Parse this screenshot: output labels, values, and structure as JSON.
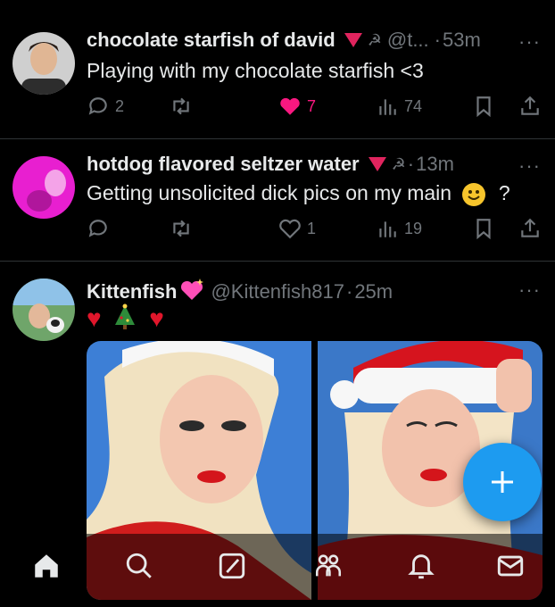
{
  "posts": [
    {
      "author": "chocolate starfish of david",
      "handle": "@t...",
      "time": "53m",
      "text": "Playing with my chocolate starfish <3",
      "replies": "2",
      "reposts": "",
      "likes": "7",
      "views": "74",
      "liked": true
    },
    {
      "author": "hotdog flavored seltzer water",
      "handle": "",
      "time": "13m",
      "text": "Getting unsolicited dick pics on my main",
      "text_suffix": "?",
      "replies": "",
      "reposts": "",
      "likes": "1",
      "views": "19",
      "liked": false
    },
    {
      "author": "Kittenfish",
      "handle": "@Kittenfish817",
      "time": "25m",
      "text": "",
      "emoji_line": "♥ 🎄 ♥"
    }
  ],
  "separator": "·",
  "more": "···",
  "colors": {
    "background": "#000000",
    "text": "#e7e9ea",
    "muted": "#71767b",
    "like": "#f91880",
    "accent": "#1d9bf0",
    "flag": "#e0245e"
  },
  "icons": {
    "reply": "speech-bubble-icon",
    "repost": "repost-icon",
    "like": "heart-icon",
    "views": "bar-chart-icon",
    "bookmark": "bookmark-icon",
    "share": "share-icon",
    "compose": "plus-icon"
  },
  "nav": [
    "home-icon",
    "search-icon",
    "grok-icon",
    "communities-icon",
    "bell-icon",
    "mail-icon"
  ]
}
